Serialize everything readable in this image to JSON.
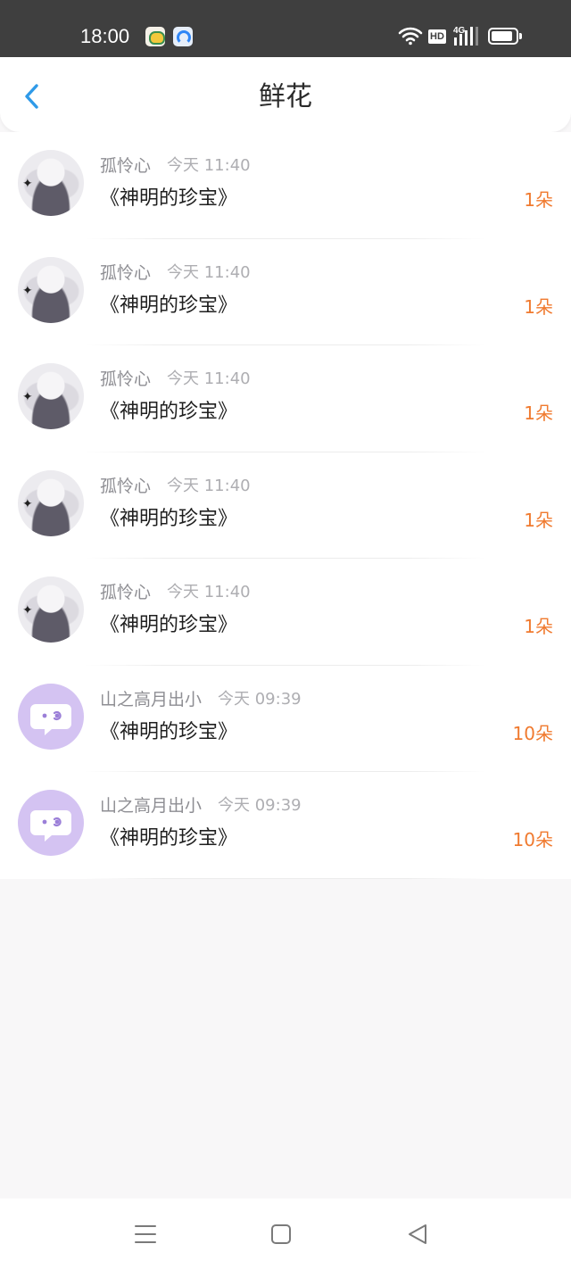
{
  "status_bar": {
    "time": "18:00",
    "network": "4G",
    "hd": "HD",
    "icons": [
      "notification-app-icon",
      "browser-app-icon",
      "wifi-icon",
      "hd-icon",
      "signal-icon",
      "battery-icon"
    ]
  },
  "header": {
    "title": "鲜花",
    "back_icon": "chevron-left-icon",
    "accent_color": "#2f9ae8"
  },
  "gifts": [
    {
      "nickname": "孤怜心",
      "time": "今天 11:40",
      "book": "《神明的珍宝》",
      "amount": "1朵",
      "avatar": "photo"
    },
    {
      "nickname": "孤怜心",
      "time": "今天 11:40",
      "book": "《神明的珍宝》",
      "amount": "1朵",
      "avatar": "photo"
    },
    {
      "nickname": "孤怜心",
      "time": "今天 11:40",
      "book": "《神明的珍宝》",
      "amount": "1朵",
      "avatar": "photo"
    },
    {
      "nickname": "孤怜心",
      "time": "今天 11:40",
      "book": "《神明的珍宝》",
      "amount": "1朵",
      "avatar": "photo"
    },
    {
      "nickname": "孤怜心",
      "time": "今天 11:40",
      "book": "《神明的珍宝》",
      "amount": "1朵",
      "avatar": "photo"
    },
    {
      "nickname": "山之高月出小",
      "time": "今天 09:39",
      "book": "《神明的珍宝》",
      "amount": "10朵",
      "avatar": "default-bubble"
    },
    {
      "nickname": "山之高月出小",
      "time": "今天 09:39",
      "book": "《神明的珍宝》",
      "amount": "10朵",
      "avatar": "default-bubble"
    }
  ],
  "colors": {
    "amount": "#f07a2f",
    "nickname": "#8e8e93",
    "default_avatar": "#d4c3f2"
  },
  "nav_bar": {
    "icons": [
      "menu-icon",
      "home-square-icon",
      "back-triangle-icon"
    ]
  }
}
